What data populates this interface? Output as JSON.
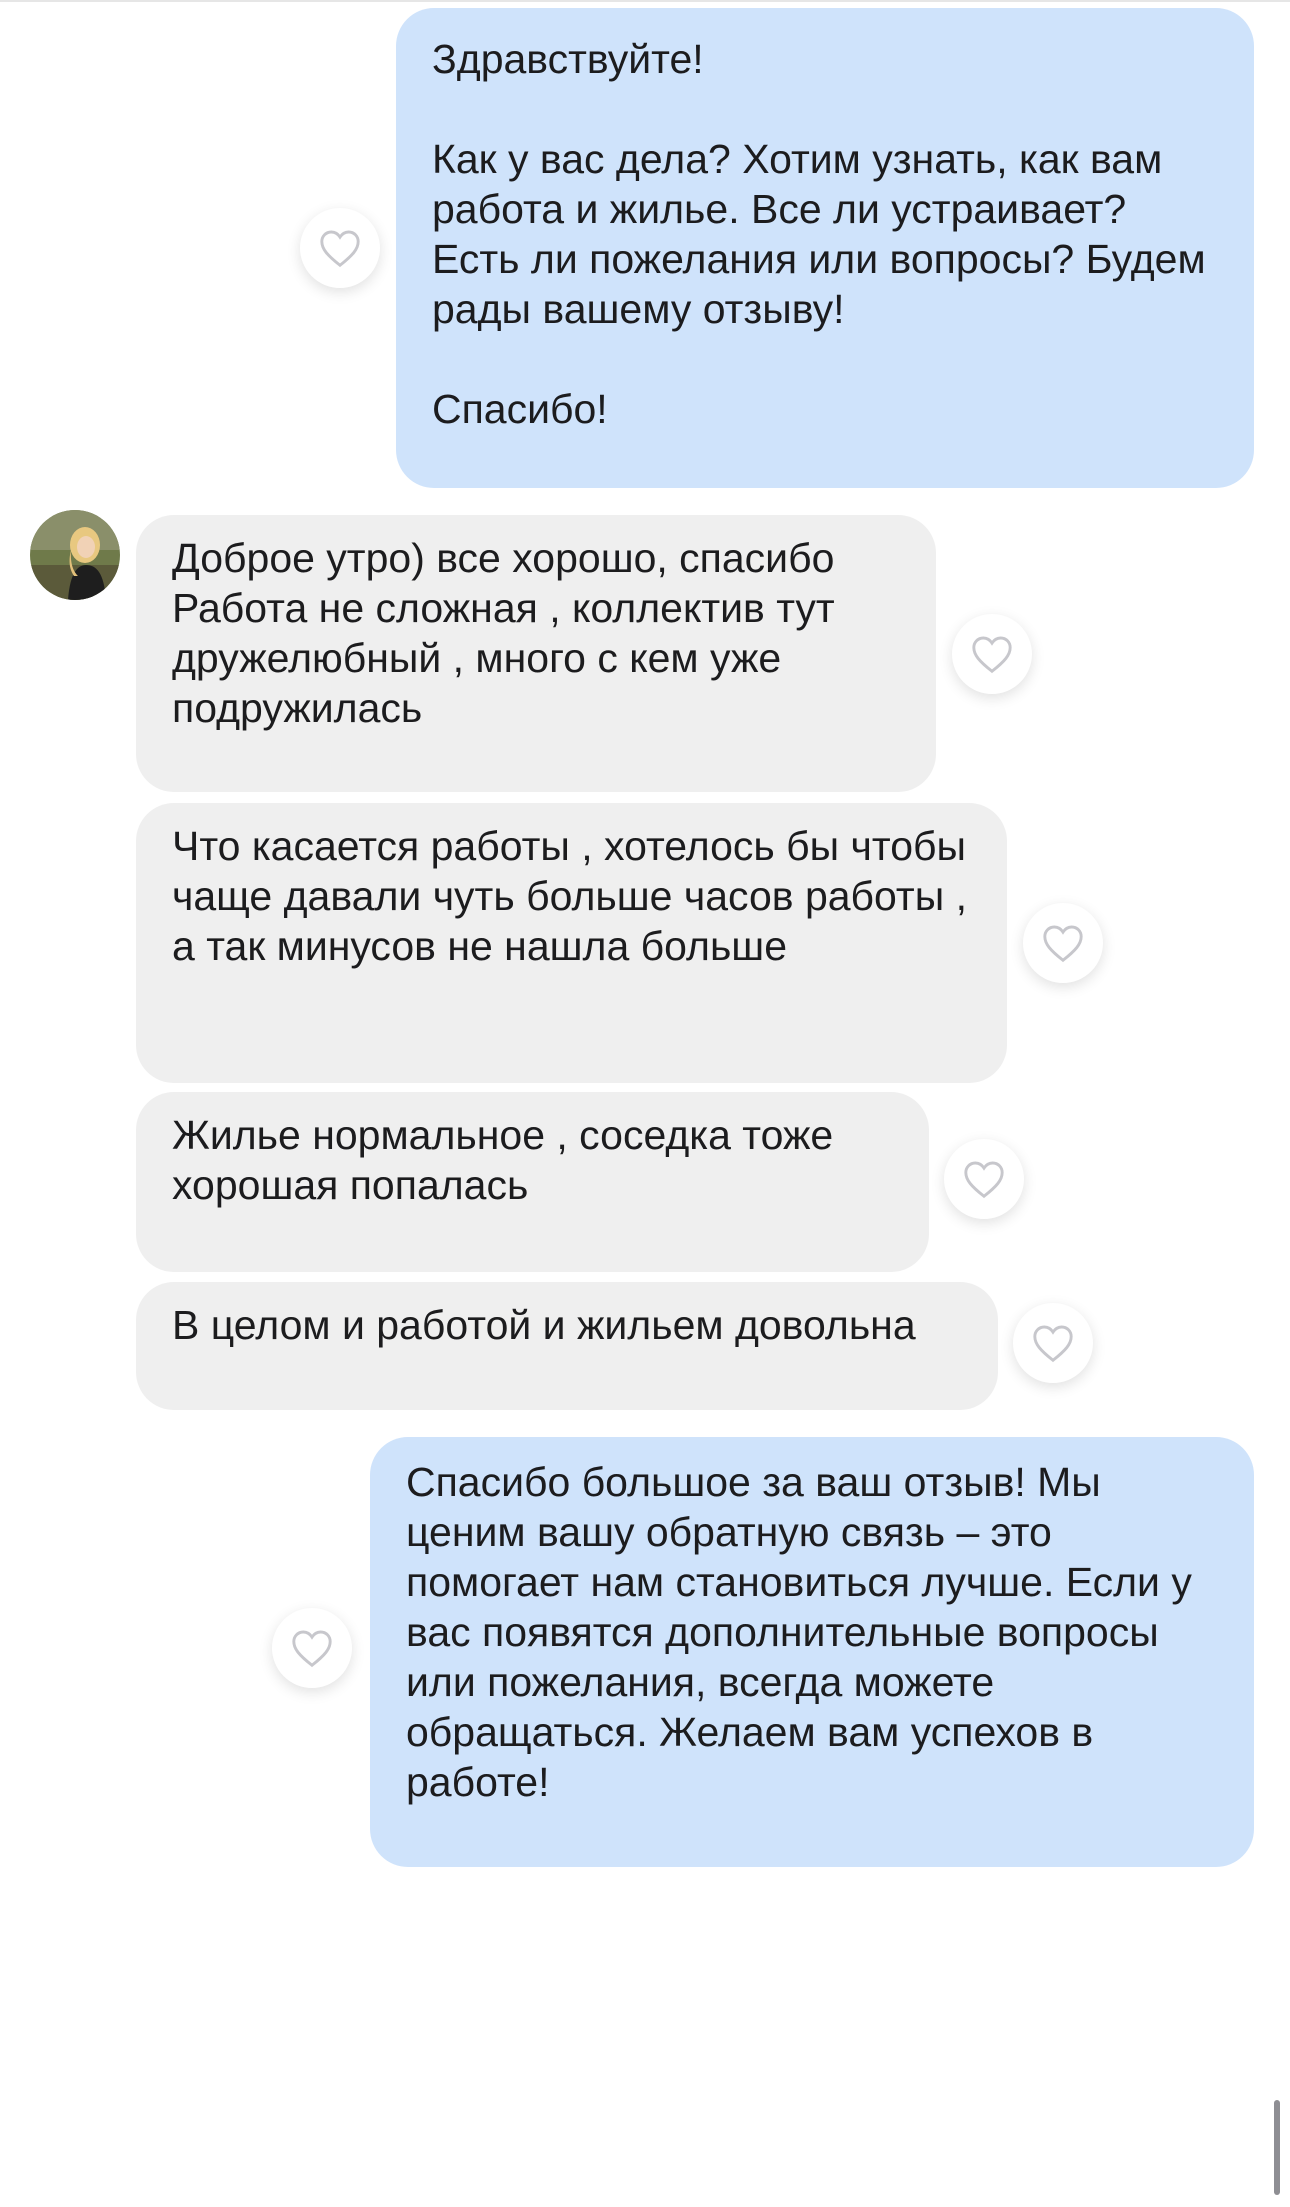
{
  "colors": {
    "outgoing_bubble": "#cfe3fb",
    "incoming_bubble": "#efefef",
    "text": "#1c1c1e",
    "like_icon": "#c7c7cc"
  },
  "icons": {
    "like": "heart-outline-icon",
    "avatar": "user-photo"
  },
  "messages": [
    {
      "direction": "outgoing",
      "text": "Здравствуйте!\n\nКак у вас дела? Хотим узнать, как вам работа и жилье. Все ли устраивает? Есть ли пожелания или вопросы? Будем рады вашему отзыву!\n\nСпасибо!"
    },
    {
      "direction": "incoming",
      "text": "Доброе утро) все хорошо, спасибо\nРабота не сложная , коллектив тут дружелюбный , много с кем уже подружилась"
    },
    {
      "direction": "incoming",
      "text": "Что касается работы , хотелось бы чтобы чаще давали чуть больше часов работы , а так минусов не нашла больше"
    },
    {
      "direction": "incoming",
      "text": "Жилье нормальное , соседка тоже хорошая попалась"
    },
    {
      "direction": "incoming",
      "text": "В целом и работой и жильем довольна"
    },
    {
      "direction": "outgoing",
      "text": "Спасибо большое за ваш отзыв! Мы ценим вашу обратную связь – это помогает нам становиться лучше. Если у вас появятся дополнительные вопросы или пожелания, всегда можете обращаться. Желаем вам успехов в работе!"
    }
  ]
}
